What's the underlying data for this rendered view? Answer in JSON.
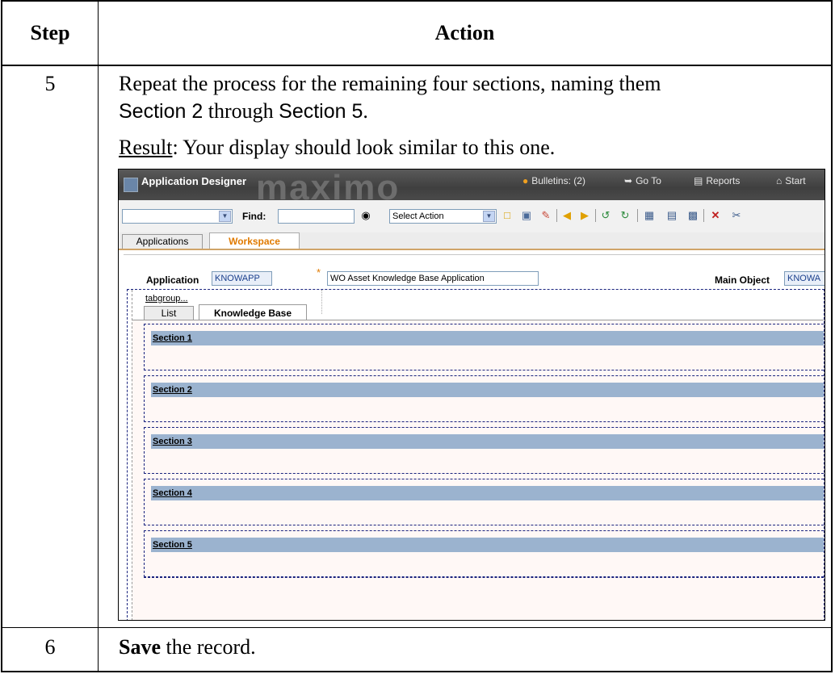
{
  "table": {
    "header_step": "Step",
    "header_action": "Action"
  },
  "row5": {
    "step": "5",
    "line1": "Repeat the process for the remaining four sections, naming them",
    "section_from": "Section 2",
    "through": " through ",
    "section_to": "Section 5",
    "period": ".",
    "result_label": "Result",
    "result_text": ": Your display should look similar to this one."
  },
  "screenshot": {
    "title": "Application Designer",
    "logo": "maximo",
    "bulletins": "Bulletins: (2)",
    "goto": "Go To",
    "reports": "Reports",
    "start": "Start",
    "find_label": "Find:",
    "select_action": "Select Action",
    "tabs": [
      "Applications",
      "Workspace"
    ],
    "application_label": "Application",
    "application_value": "KNOWAPP",
    "description_value": "WO Asset Knowledge Base Application",
    "main_object_label": "Main Object",
    "main_object_value": "KNOWA",
    "tabgroup_label": "tabgroup...",
    "subtabs": [
      "List",
      "Knowledge Base"
    ],
    "sections": [
      "Section 1",
      "Section 2",
      "Section 3",
      "Section 4",
      "Section 5"
    ]
  },
  "row6": {
    "step": "6",
    "save": "Save",
    "rest": " the record."
  }
}
